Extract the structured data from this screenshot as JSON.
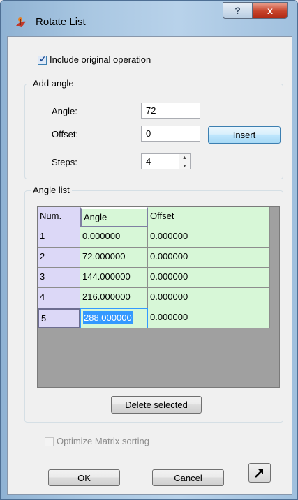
{
  "window": {
    "title": "Rotate List",
    "help_label": "?",
    "close_label": "x"
  },
  "include_original": {
    "label": "Include original operation",
    "checked": true
  },
  "add_angle": {
    "group_title": "Add angle",
    "angle_label": "Angle:",
    "angle_value": "72",
    "offset_label": "Offset:",
    "offset_value": "0",
    "steps_label": "Steps:",
    "steps_value": "4",
    "insert_label": "Insert"
  },
  "angle_list": {
    "group_title": "Angle list",
    "columns": [
      "Num.",
      "Angle",
      "Offset"
    ],
    "rows": [
      {
        "num": "1",
        "angle": "0.000000",
        "offset": "0.000000"
      },
      {
        "num": "2",
        "angle": "72.000000",
        "offset": "0.000000"
      },
      {
        "num": "3",
        "angle": "144.000000",
        "offset": "0.000000"
      },
      {
        "num": "4",
        "angle": "216.000000",
        "offset": "0.000000"
      },
      {
        "num": "5",
        "angle": "288.000000",
        "offset": "0.000000"
      }
    ],
    "delete_label": "Delete selected"
  },
  "optimize": {
    "label": "Optimize Matrix  sorting",
    "checked": false,
    "enabled": false
  },
  "footer": {
    "ok_label": "OK",
    "cancel_label": "Cancel"
  },
  "colors": {
    "header": "#d9d5f5",
    "cell": "#d7f7d7",
    "selection": "#3399ff",
    "empty_area": "#a0a0a0"
  }
}
